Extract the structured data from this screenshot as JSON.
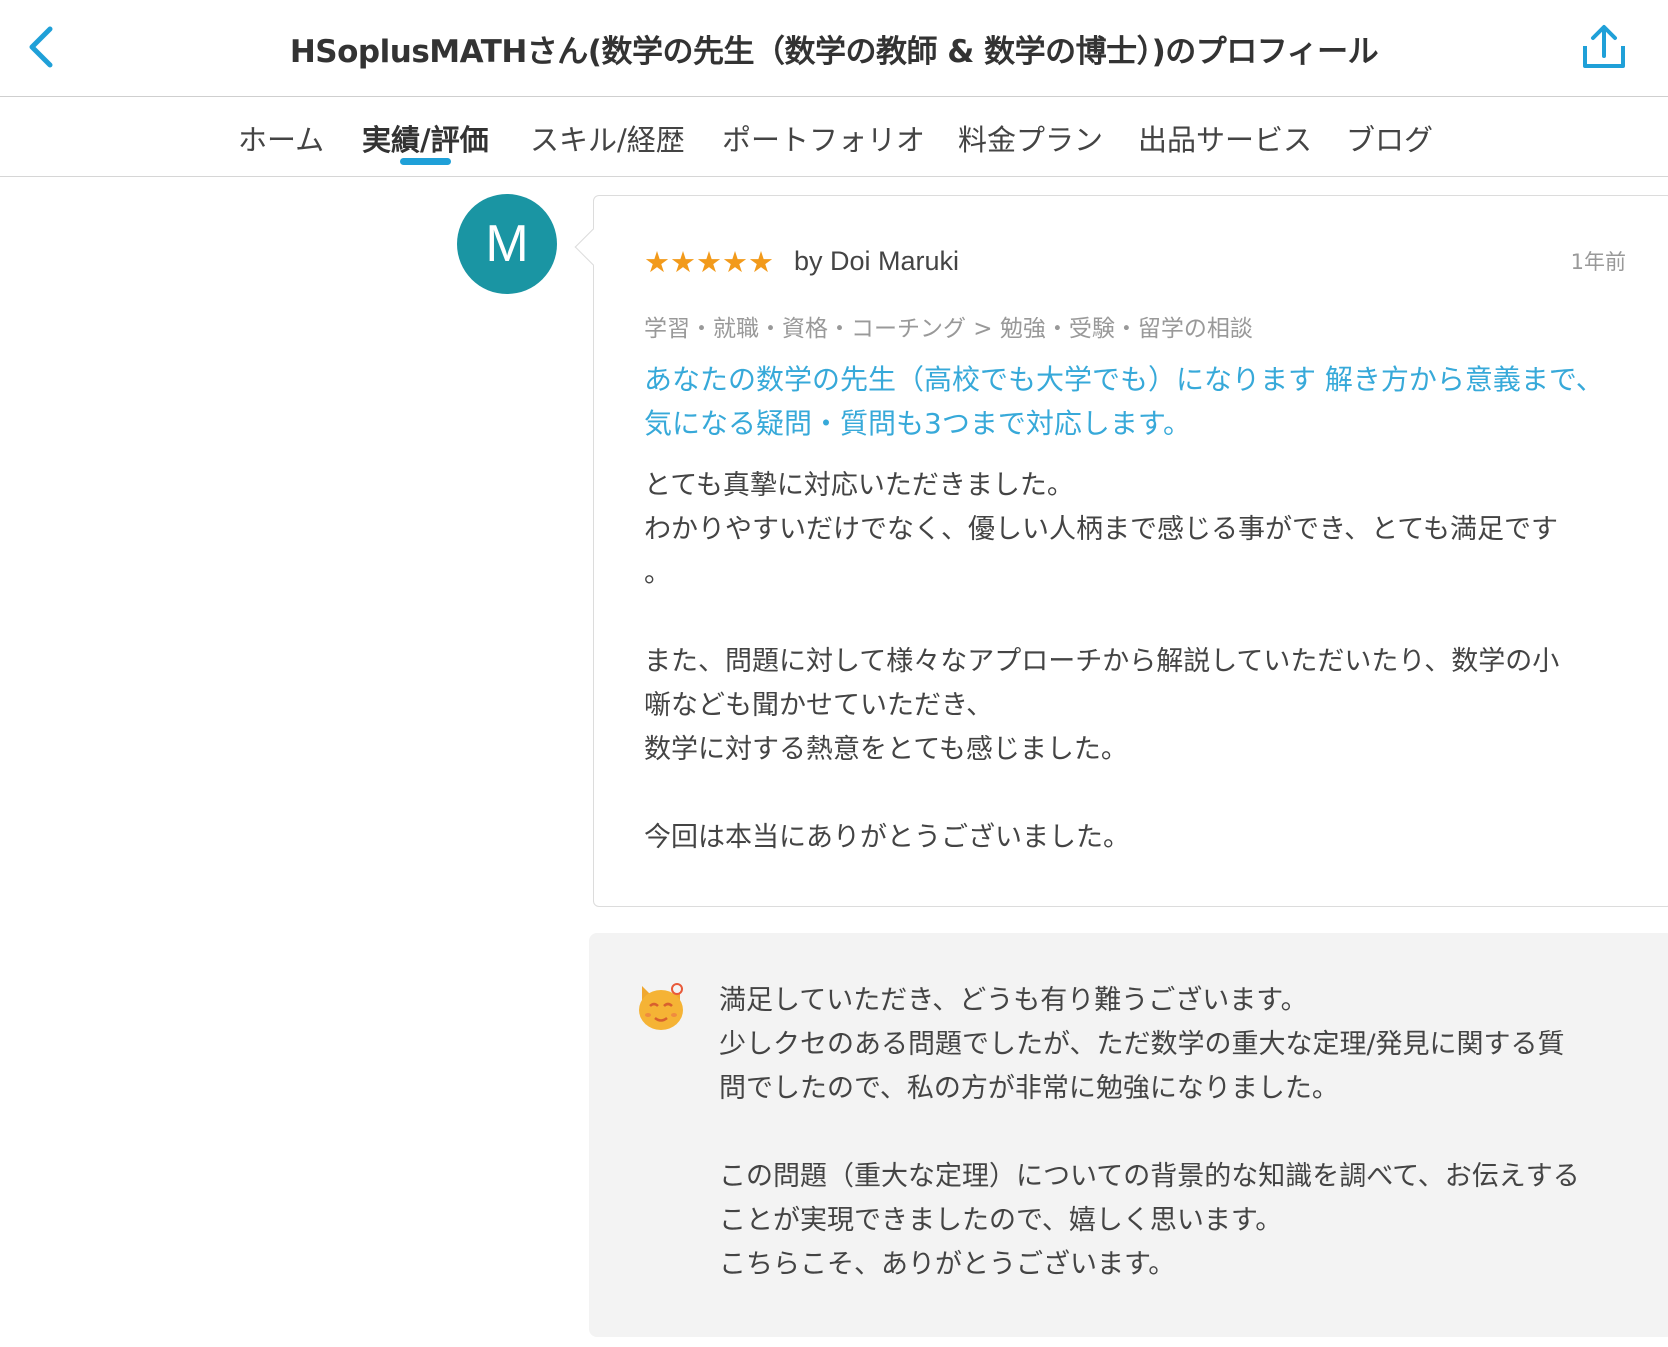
{
  "header": {
    "title": "HSoplusMATHさん(数学の先生（数学の教師 & 数学の博士）)のプロフィール",
    "back_icon": "chevron-left-icon",
    "share_icon": "share-icon",
    "accent_color": "#1fa0d8"
  },
  "tabs": [
    {
      "label": "ホーム",
      "active": false
    },
    {
      "label": "実績/評価",
      "active": true
    },
    {
      "label": "スキル/経歴",
      "active": false
    },
    {
      "label": "ポートフォリオ",
      "active": false
    },
    {
      "label": "料金プラン",
      "active": false
    },
    {
      "label": "出品サービス",
      "active": false
    },
    {
      "label": "ブログ",
      "active": false
    }
  ],
  "review": {
    "avatar_letter": "M",
    "avatar_color": "#1a95a3",
    "rating": 5,
    "stars": "★★★★★",
    "reviewer": "by Doi Maruki",
    "time": "1年前",
    "category": "学習・就職・資格・コーチング > 勉強・受験・留学の相談",
    "service_title": "あなたの数学の先生（高校でも大学でも）になります 解き方から意義まで、気になる疑問・質問も3つまで対応します。",
    "body_lines": [
      "とても真摯に対応いただきました。",
      "わかりやすいだけでなく、優しい人柄まで感じる事ができ、とても満足です",
      "。",
      "",
      "また、問題に対して様々なアプローチから解説していただいたり、数学の小",
      "噺なども聞かせていただき、",
      "数学に対する熱意をとても感じました。",
      "",
      "今回は本当にありがとうございました。"
    ]
  },
  "reply": {
    "icon": "seller-cat-avatar-icon",
    "body_lines": [
      "満足していただき、どうも有り難うございます。",
      "少しクセのある問題でしたが、ただ数学の重大な定理/発見に関する質",
      "問でしたので、私の方が非常に勉強になりました。",
      "",
      "この問題（重大な定理）についての背景的な知識を調べて、お伝えする",
      "ことが実現できましたので、嬉しく思います。",
      "こちらこそ、ありがとうございます。"
    ]
  }
}
